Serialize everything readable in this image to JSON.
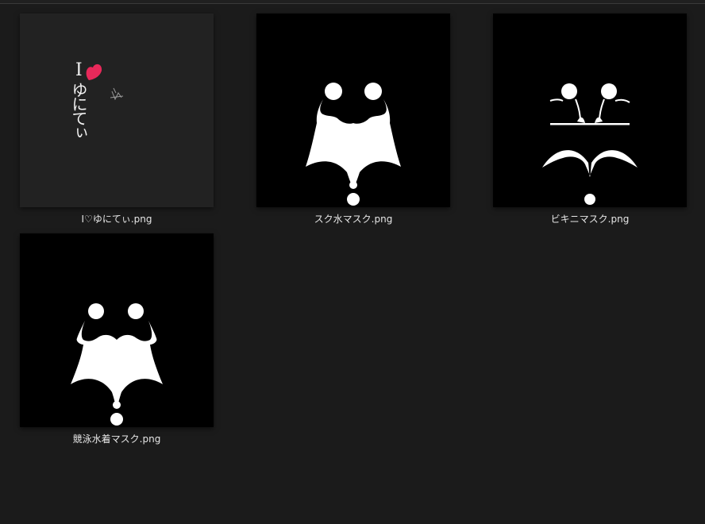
{
  "colors": {
    "background": "#1b1b1b",
    "caption_text": "#e6e6e6",
    "heart": "#e8295a"
  },
  "files": [
    {
      "name": "I♡ゆにてぃ.png",
      "thumb_text": "ゆにてぃ",
      "thumb_letter": "I",
      "icon": "heart-icon"
    },
    {
      "name": "スク水マスク.png"
    },
    {
      "name": "ビキニマスク.png"
    },
    {
      "name": "競泳水着マスク.png"
    }
  ]
}
